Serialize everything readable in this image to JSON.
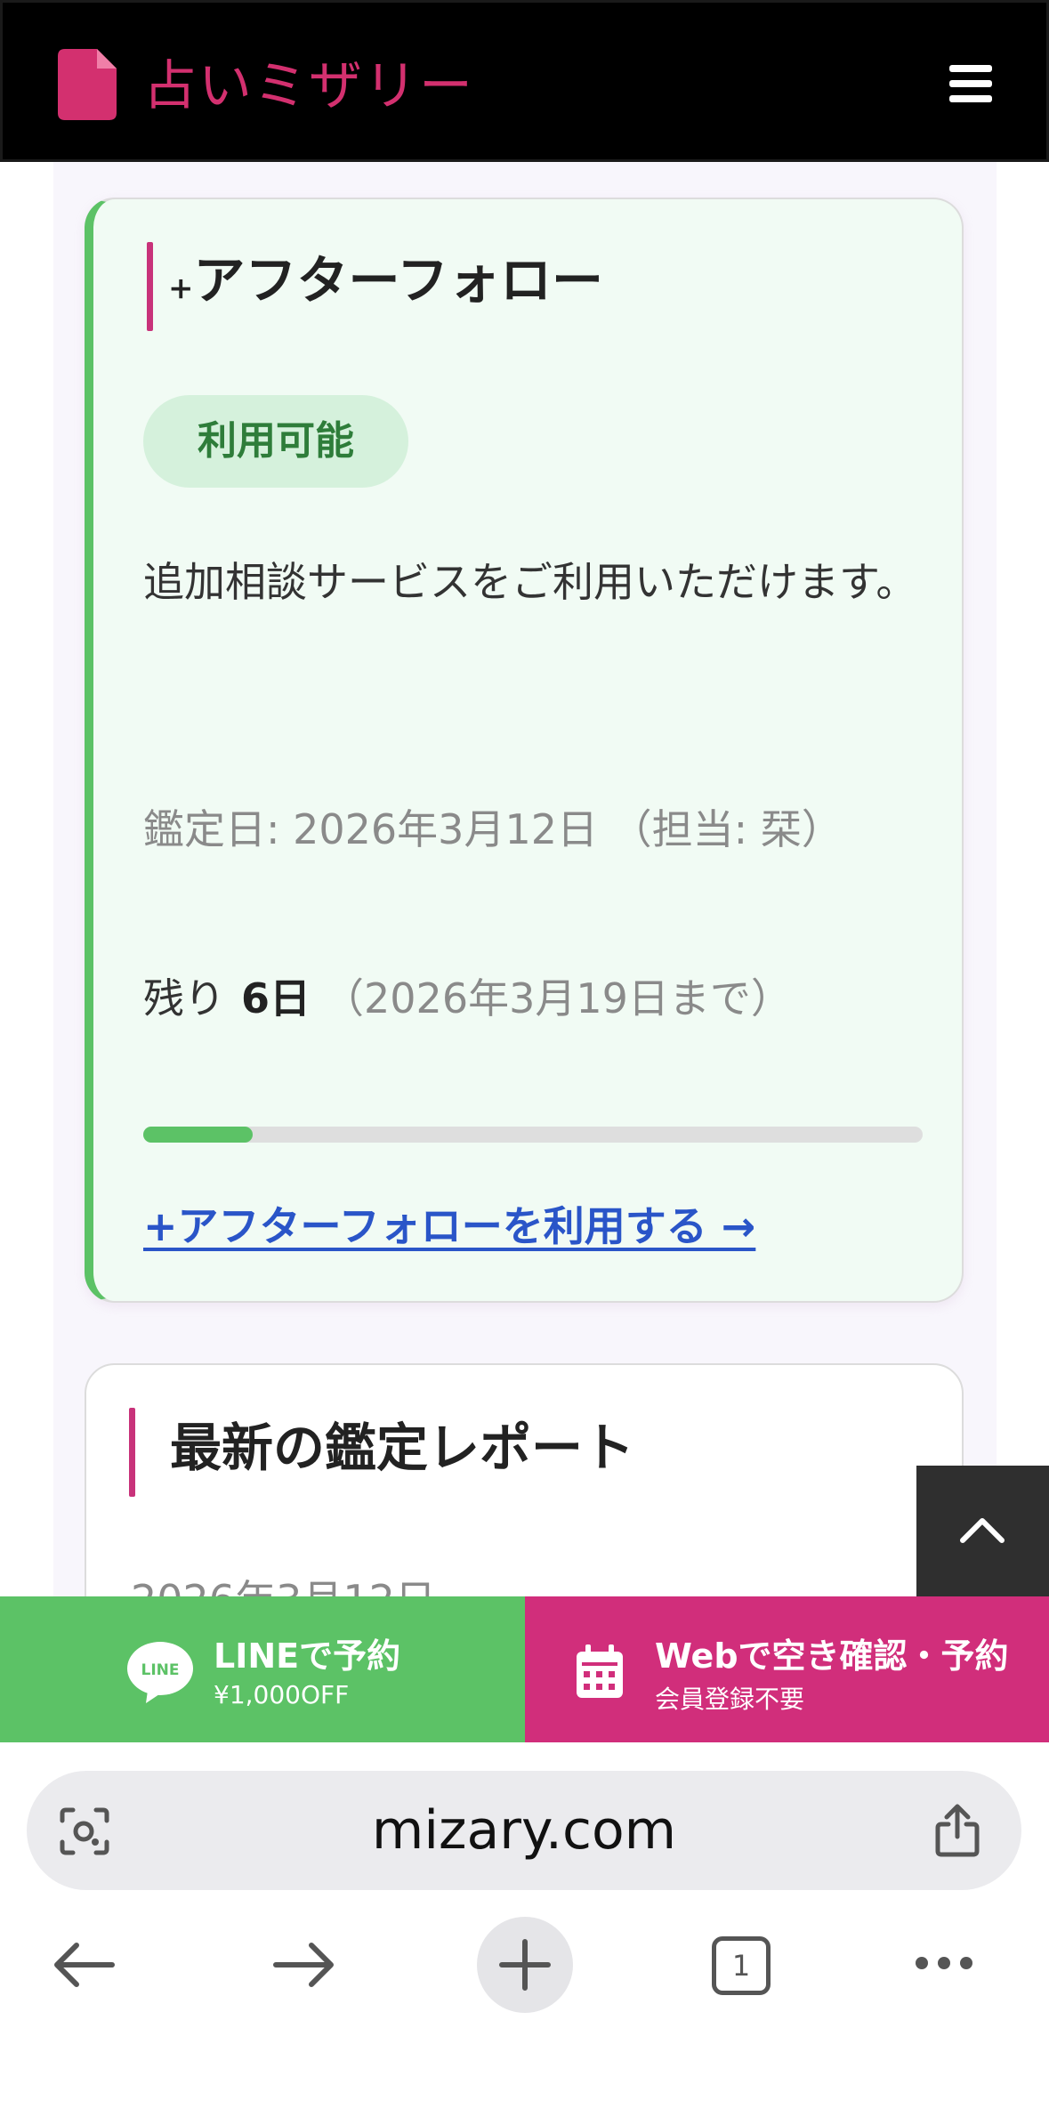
{
  "header": {
    "logo_text": "占いミザリー"
  },
  "after_follow_card": {
    "title_prefix": "+",
    "title": "アフターフォロー",
    "badge": "利用可能",
    "description": "追加相談サービスをご利用いただけます。",
    "date_line": "鑑定日: 2026年3月12日 （担当: 栞）",
    "remain_label": "残り",
    "remain_days": "6日",
    "remain_until": "（2026年3月19日まで）",
    "progress_fraction": 0.14,
    "link_label": "+アフターフォローを利用する →"
  },
  "report_card": {
    "title": "最新の鑑定レポート",
    "date_partial": "2026年3月12日"
  },
  "action_bar": {
    "line_label": "LINEで予約",
    "line_sub": "¥1,000OFF",
    "line_icon_text": "LINE",
    "web_label": "Webで空き確認・予約",
    "web_sub": "会員登録不要"
  },
  "browser": {
    "url": "mizary.com",
    "tab_count": "1"
  },
  "colors": {
    "accent_pink": "#d12e7b",
    "accent_green": "#5cc266",
    "link_blue": "#2a55c8"
  }
}
